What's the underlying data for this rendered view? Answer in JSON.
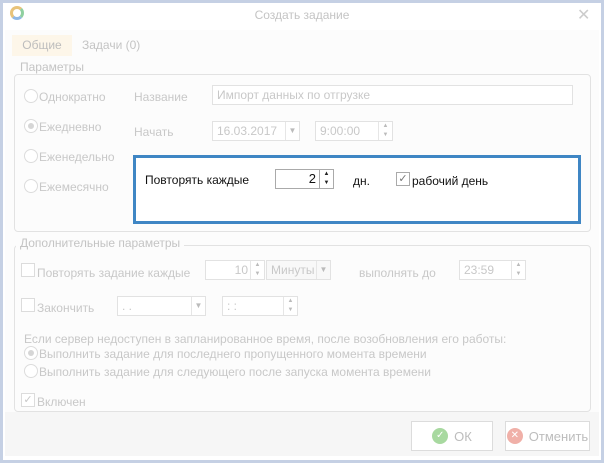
{
  "title": "Создать задание",
  "tabs": [
    {
      "label": "Общие"
    },
    {
      "label": "Задачи (0)"
    }
  ],
  "params": {
    "legend": "Параметры",
    "radios": [
      "Однократно",
      "Ежедневно",
      "Еженедельно",
      "Ежемесячно"
    ],
    "name_label": "Название",
    "name_value": "Импорт данных по отгрузке",
    "start_label": "Начать",
    "start_date": "16.03.2017",
    "start_time": "9:00:00",
    "repeat_label": "Повторять каждые",
    "repeat_value": "2",
    "repeat_unit": "дн.",
    "workday_label": "рабочий день",
    "highlight_color": "#3f86c4"
  },
  "extra": {
    "legend": "Дополнительные параметры",
    "repeat_task_label": "Повторять задание каждые",
    "repeat_task_value": "10",
    "repeat_task_unit": "Минуты",
    "until_label": "выполнять до",
    "until_value": "23:59",
    "finish_label": "Закончить",
    "finish_date": ". .",
    "finish_time": ": :",
    "server_note": "Если сервер недоступен в запланированное время, после возобновления его работы:",
    "option1": "Выполнить задание для последнего пропущенного момента времени",
    "option2": "Выполнить задание для следующего после запуска момента времени",
    "enabled_label": "Включен"
  },
  "footer": {
    "ok": "ОК",
    "cancel": "Отменить"
  }
}
